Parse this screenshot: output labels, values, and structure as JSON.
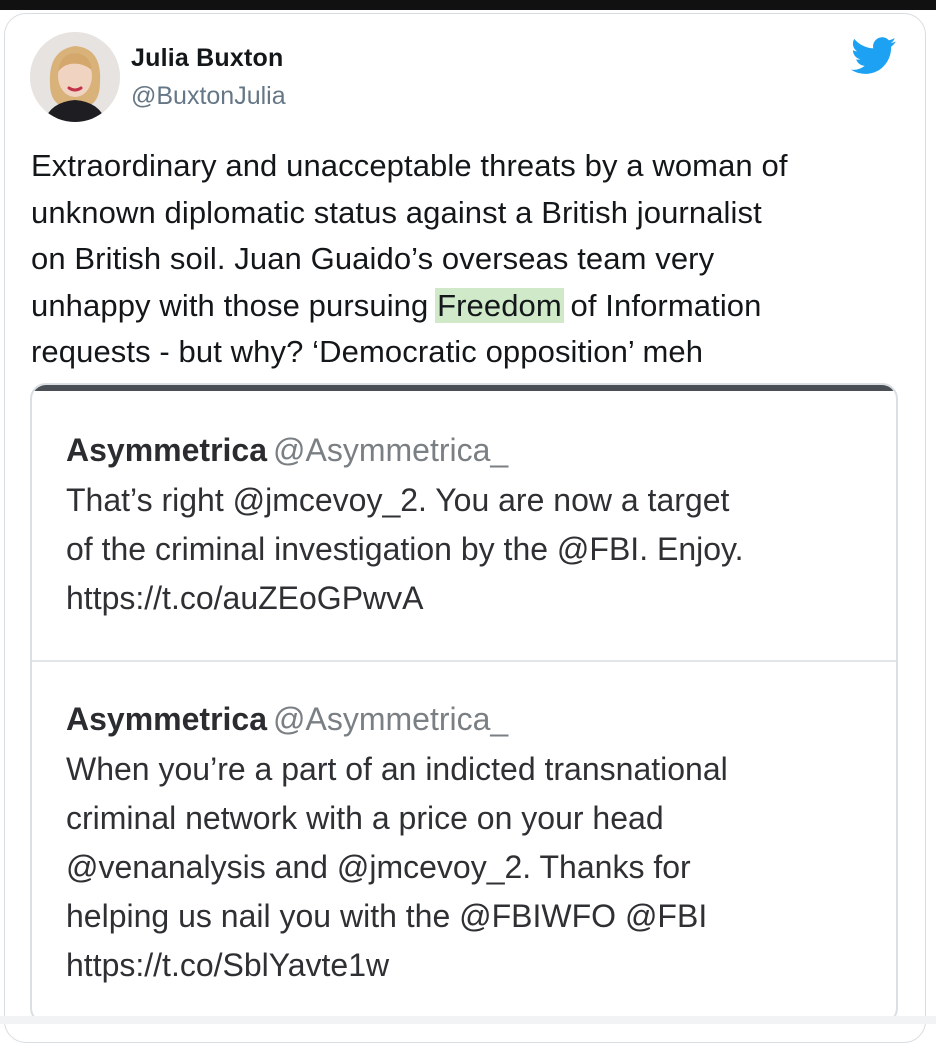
{
  "tweet": {
    "author": {
      "display_name": "Julia Buxton",
      "handle": "@BuxtonJulia"
    },
    "text_lines": [
      "Extraordinary and unacceptable threats by a woman of",
      "unknown diplomatic status against a British journalist",
      "on British soil. Juan Guaido’s overseas team very"
    ],
    "line4_before": "unhappy with those pursuing ",
    "line4_highlight": "Freedom",
    "line4_after": " of Information",
    "line5": "requests - but why? ‘Democratic opposition’ meh",
    "bird_icon": "twitter-bird-icon",
    "brand_color": "#1da1f2",
    "highlight_color": "#cfe9c9"
  },
  "quoted_image": {
    "tweets": [
      {
        "name": "Asymmetrica",
        "handle": "@Asymmetrica_",
        "lines": [
          "That’s right @jmcevoy_2. You are now a target",
          "of the criminal investigation by the @FBI. Enjoy.",
          "https://t.co/auZEoGPwvA"
        ]
      },
      {
        "name": "Asymmetrica",
        "handle": "@Asymmetrica_",
        "lines": [
          "When you’re a part of an indicted transnational",
          "criminal network with a price on your head",
          "@venanalysis and @jmcevoy_2. Thanks for",
          "helping us nail you with the @FBIWFO @FBI",
          "https://t.co/SblYavte1w"
        ]
      }
    ]
  }
}
